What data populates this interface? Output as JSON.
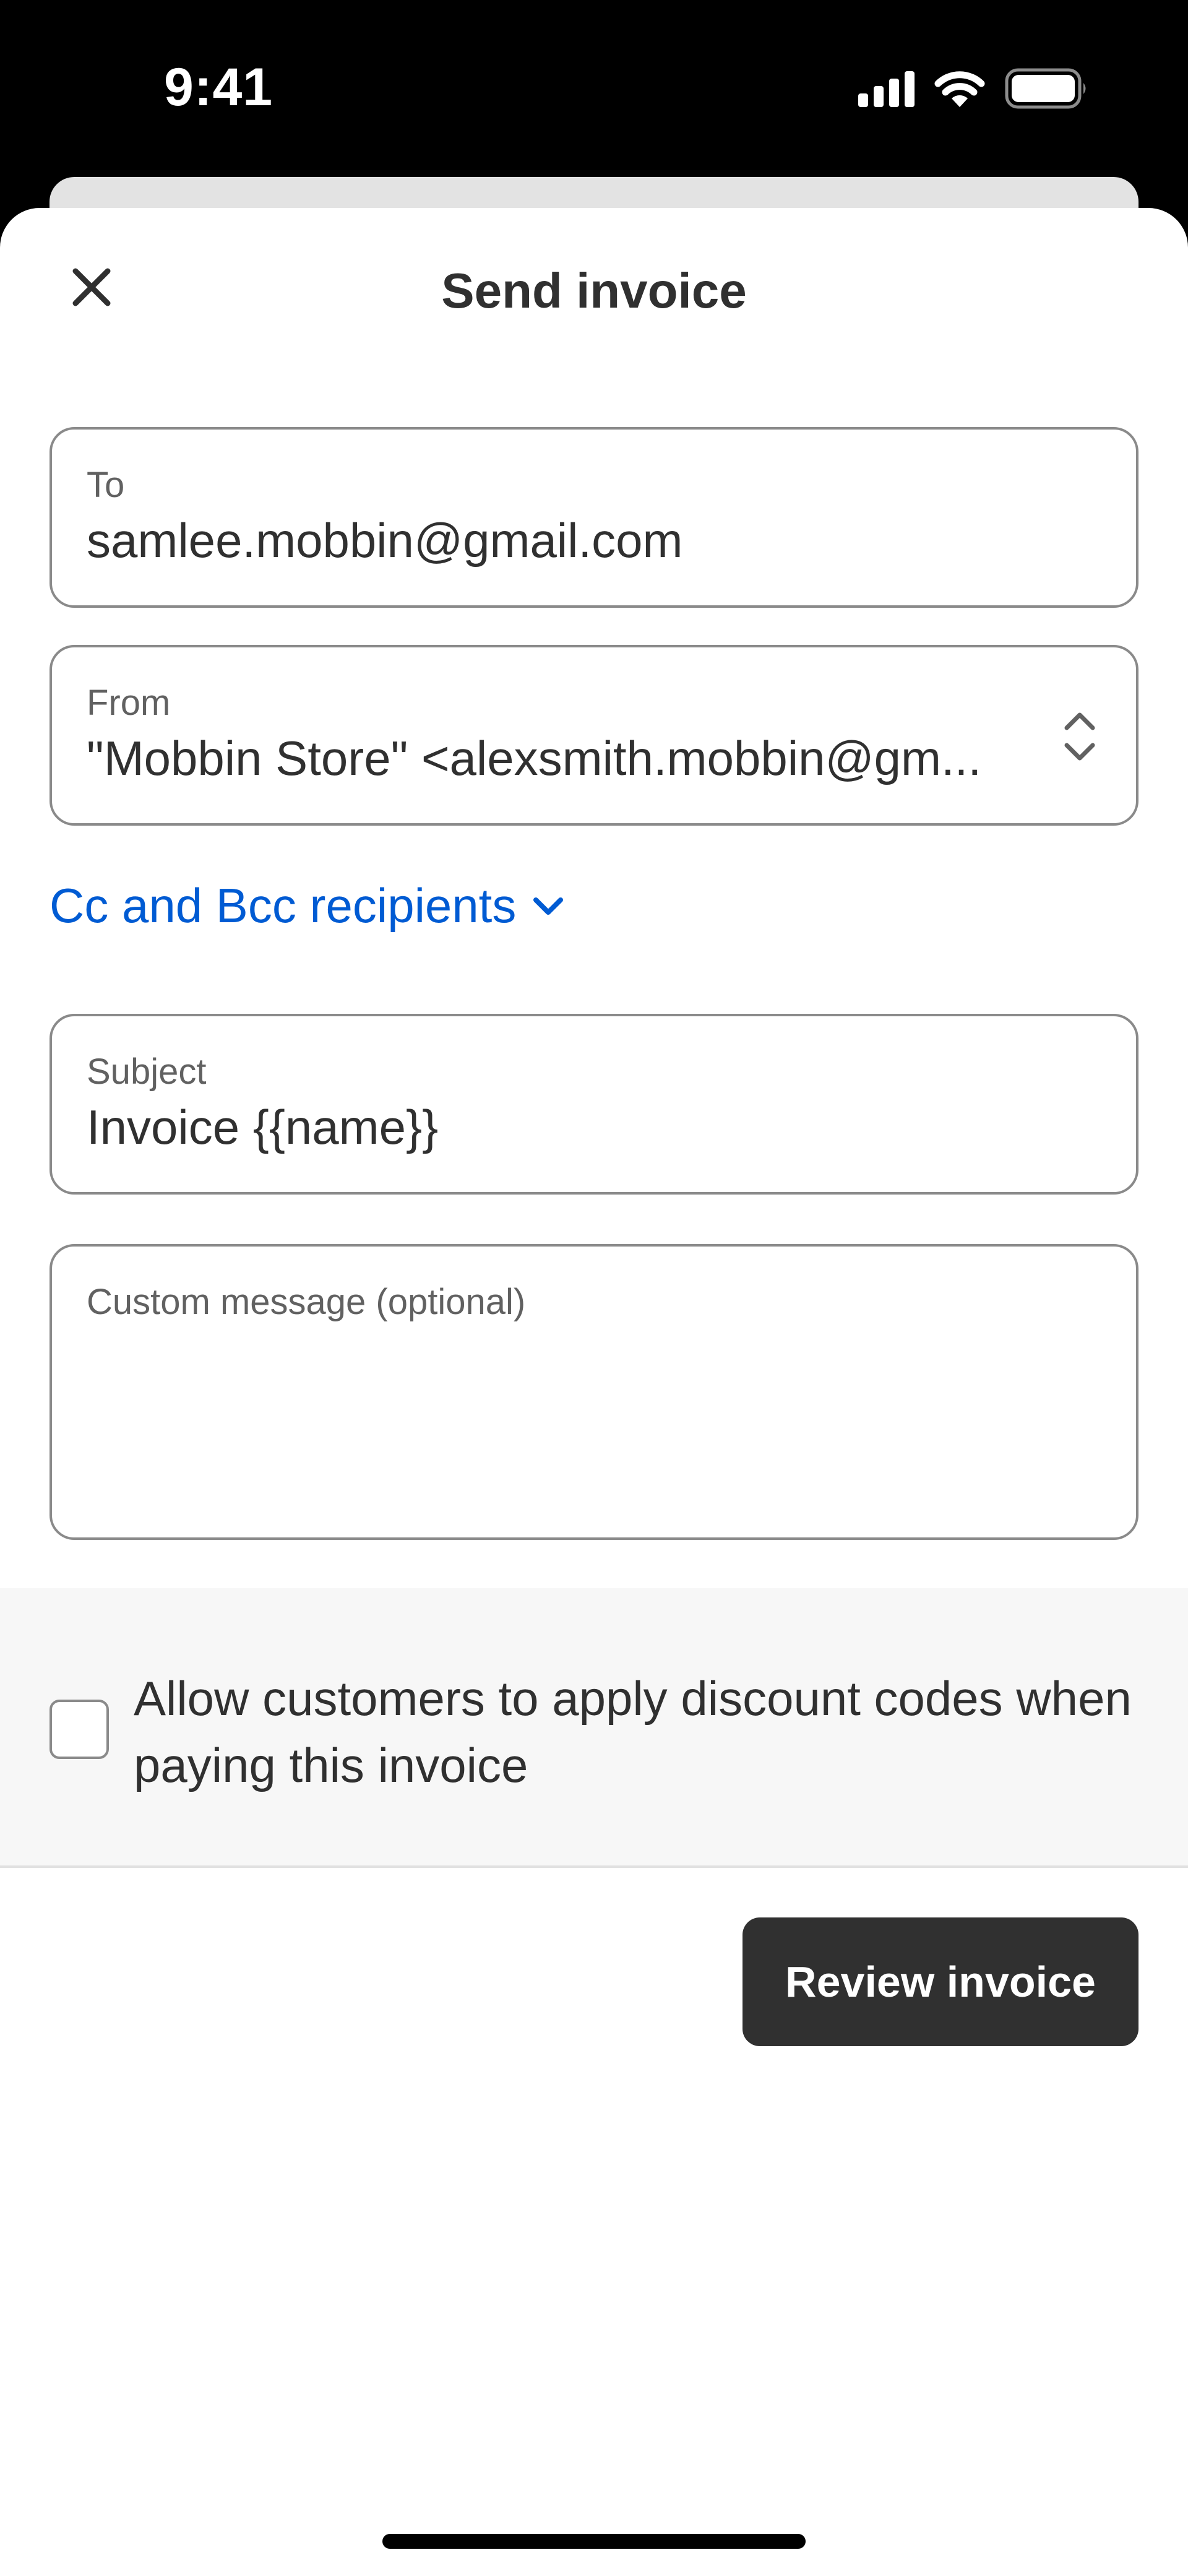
{
  "status_bar": {
    "time": "9:41",
    "icons": [
      "signal-icon",
      "wifi-icon",
      "battery-icon"
    ]
  },
  "header": {
    "title": "Send invoice",
    "close_icon": "close-icon"
  },
  "form": {
    "to": {
      "label": "To",
      "value": "samlee.mobbin@gmail.com"
    },
    "from": {
      "label": "From",
      "value": "\"Mobbin Store\" <alexsmith.mobbin@gm...",
      "icon": "chevron-up-down-icon"
    },
    "cc_bcc": {
      "label": "Cc and Bcc recipients",
      "icon": "chevron-down-icon"
    },
    "subject": {
      "label": "Subject",
      "value": "Invoice {{name}}"
    },
    "custom_message": {
      "placeholder": "Custom message (optional)",
      "value": ""
    }
  },
  "discount": {
    "checked": false,
    "text": "Allow customers to apply discount codes when paying this invoice"
  },
  "actions": {
    "review_label": "Review invoice"
  },
  "colors": {
    "accent_link": "#005bd3",
    "primary_button": "#303030",
    "section_bg": "#f7f7f7"
  }
}
